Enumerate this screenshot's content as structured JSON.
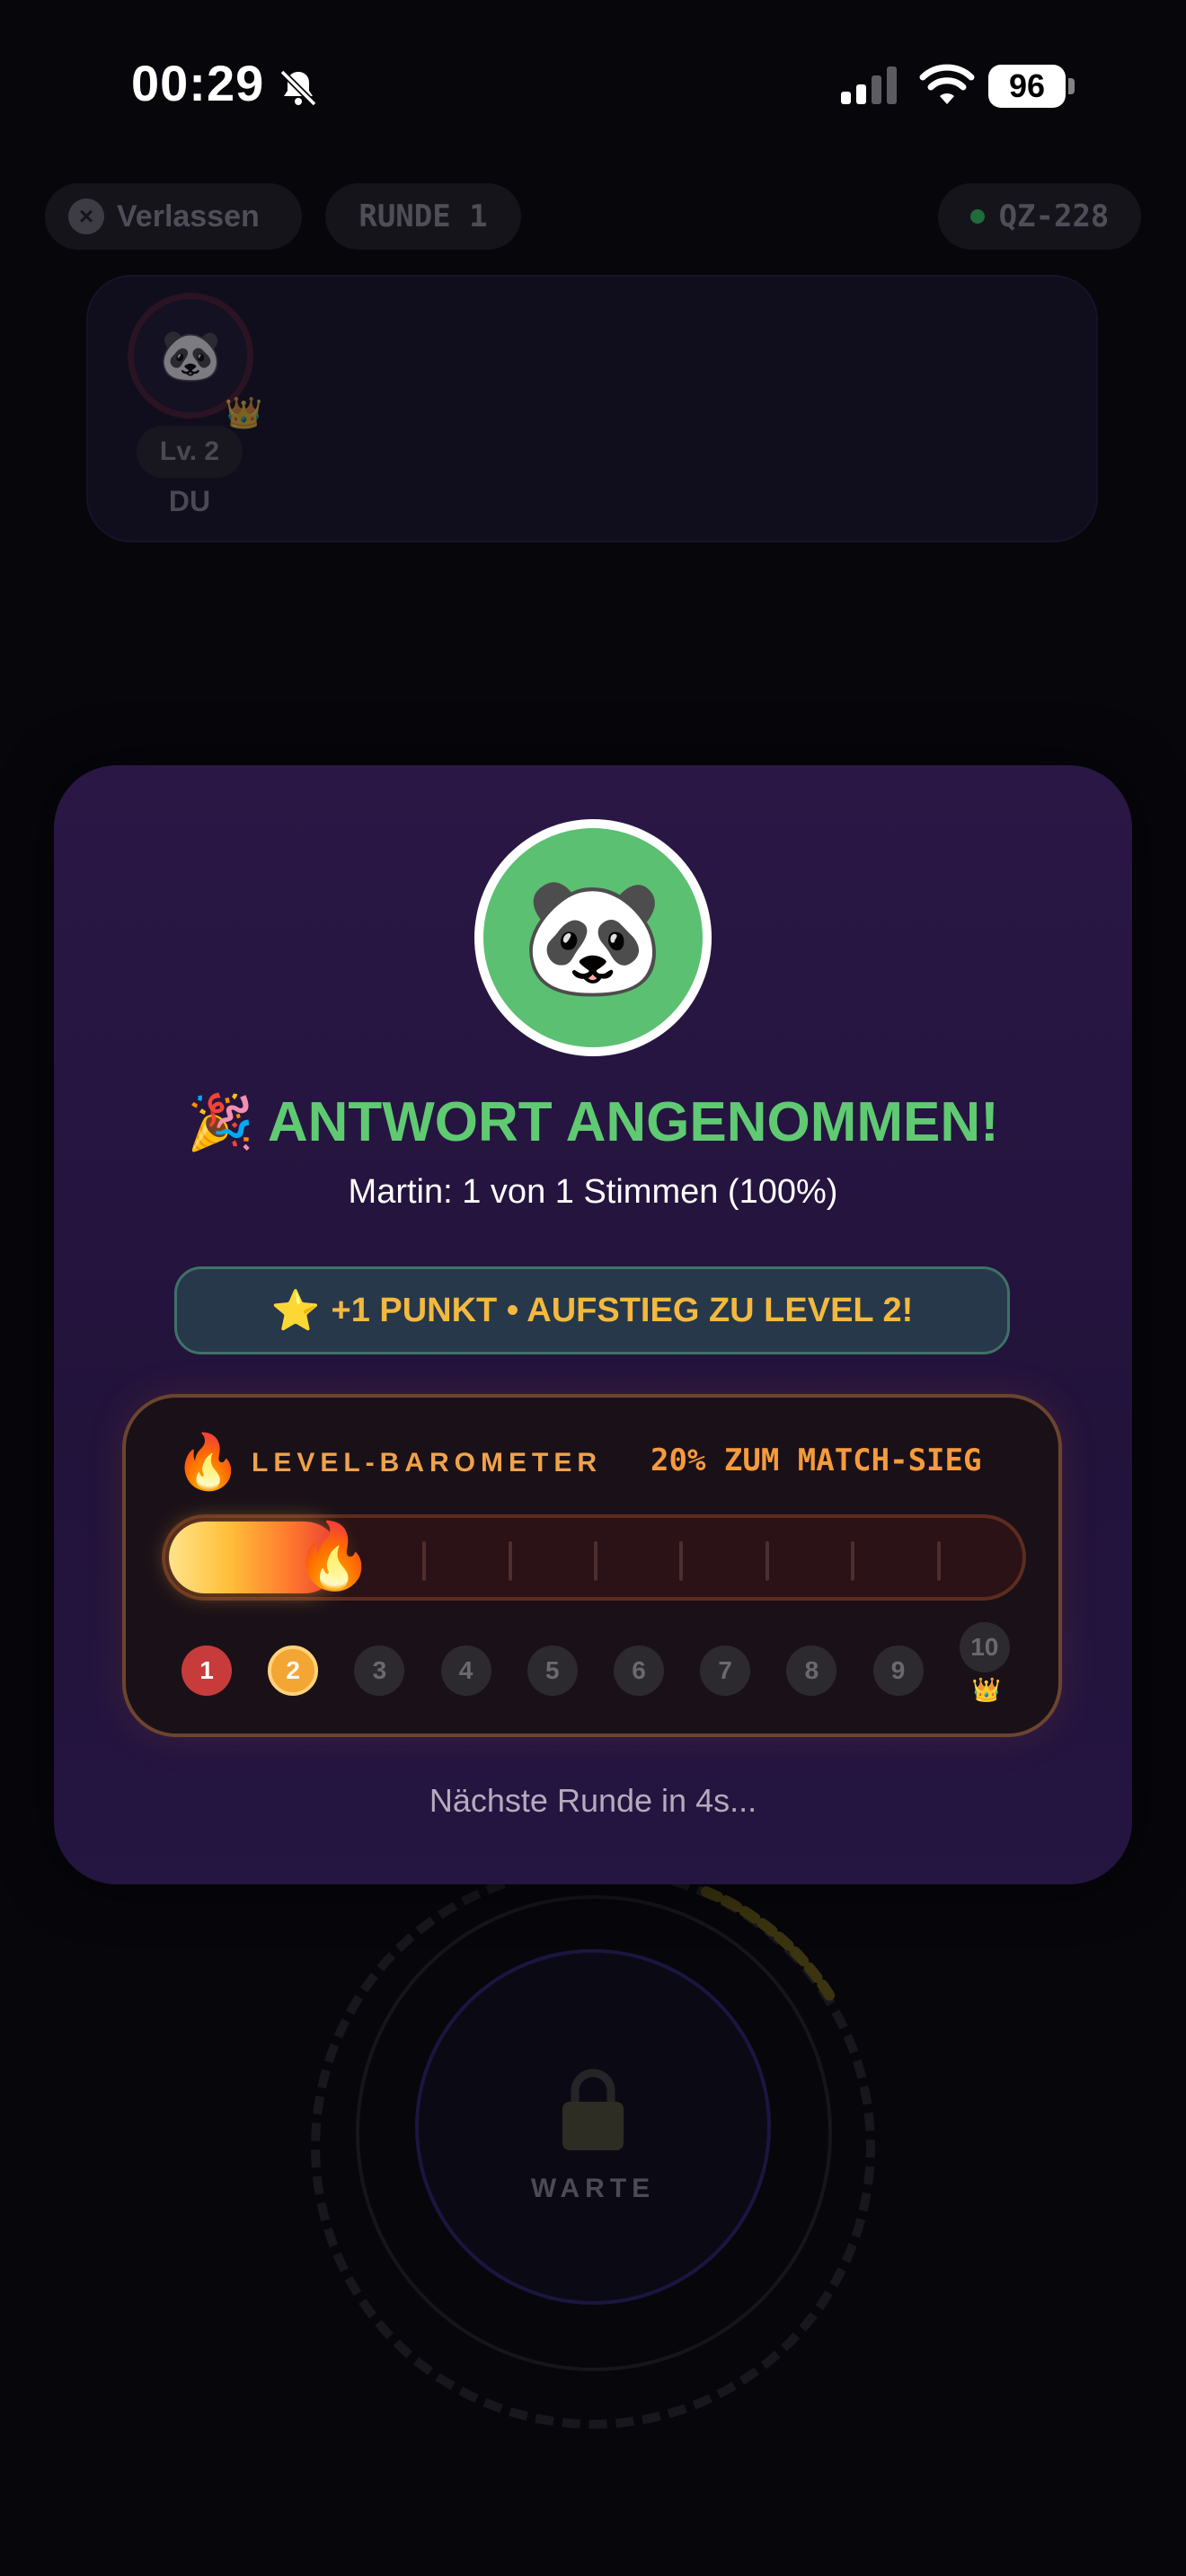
{
  "status_bar": {
    "time": "00:29",
    "battery": "96",
    "icons": [
      "bell-slash-icon",
      "cellular-signal-icon",
      "wifi-icon",
      "battery-icon"
    ]
  },
  "background": {
    "leave_label": "Verlassen",
    "round_label": "RUNDE 1",
    "room_code": "QZ-228",
    "player": {
      "level": "Lv. 2",
      "name": "DU",
      "avatar": "🐼",
      "crown": "👑"
    },
    "wait_label": "WARTE"
  },
  "modal": {
    "avatar": "🐼",
    "title_emoji": "🎉",
    "title": "ANTWORT ANGENOMMEN!",
    "subtitle": "Martin: 1 von 1 Stimmen (100%)",
    "points_star": "⭐",
    "points_text": "+1 PUNKT • AUFSTIEG ZU LEVEL 2!",
    "barometer": {
      "fire": "🔥",
      "label": "LEVEL-BAROMETER",
      "progress_text": "20% ZUM MATCH-SIEG",
      "progress_fraction": 0.2,
      "fill_flame": "🔥",
      "levels": [
        "1",
        "2",
        "3",
        "4",
        "5",
        "6",
        "7",
        "8",
        "9",
        "10"
      ],
      "current_level": 2,
      "final_crown": "👑"
    },
    "next_round": "Nächste Runde in 4s..."
  },
  "colors": {
    "title_green": "#5fca72",
    "accent_orange": "#f59a3d",
    "points_gold": "#f3b93e",
    "modal_bg": "#2a1745"
  }
}
